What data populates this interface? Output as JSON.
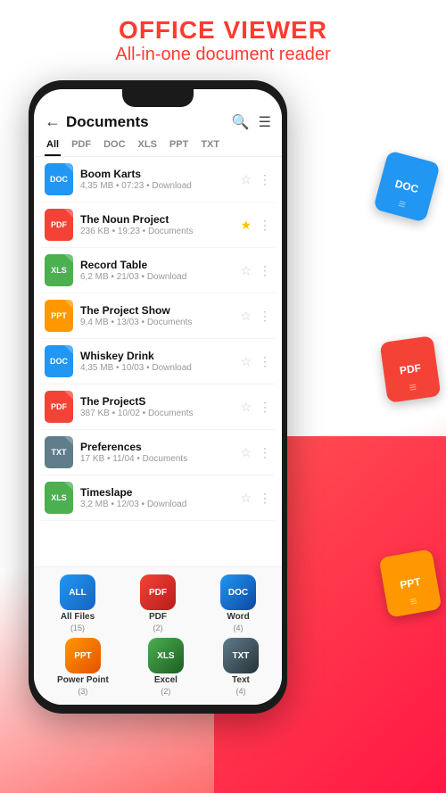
{
  "branding": {
    "title": "OFFICE VIEWER",
    "subtitle": "All-in-one document reader"
  },
  "header": {
    "title": "Documents",
    "back_icon": "←",
    "search_icon": "🔍",
    "sort_icon": "≡"
  },
  "tabs": [
    {
      "label": "All",
      "active": true
    },
    {
      "label": "PDF",
      "active": false
    },
    {
      "label": "DOC",
      "active": false
    },
    {
      "label": "XLS",
      "active": false
    },
    {
      "label": "PPT",
      "active": false
    },
    {
      "label": "TXT",
      "active": false
    }
  ],
  "files": [
    {
      "name": "Boom Karts",
      "meta": "4,35 MB • 07:23 • Download",
      "type": "doc",
      "typeLabel": "DOC",
      "starred": false
    },
    {
      "name": "The Noun Project",
      "meta": "236 KB • 19:23 • Documents",
      "type": "pdf",
      "typeLabel": "PDF",
      "starred": true
    },
    {
      "name": "Record Table",
      "meta": "6,2 MB • 21/03 • Download",
      "type": "xls",
      "typeLabel": "XLS",
      "starred": false
    },
    {
      "name": "The Project Show",
      "meta": "9,4 MB • 13/03 • Documents",
      "type": "ppt",
      "typeLabel": "PPT",
      "starred": false
    },
    {
      "name": "Whiskey Drink",
      "meta": "4,35 MB • 10/03 • Download",
      "type": "doc",
      "typeLabel": "DOC",
      "starred": false
    },
    {
      "name": "The ProjectS",
      "meta": "387 KB • 10/02 • Documents",
      "type": "pdf",
      "typeLabel": "PDF",
      "starred": false
    },
    {
      "name": "Preferences",
      "meta": "17 KB • 11/04 • Documents",
      "type": "txt",
      "typeLabel": "TXT",
      "starred": false
    },
    {
      "name": "Timeslape",
      "meta": "3,2 MB • 12/03 • Download",
      "type": "xls",
      "typeLabel": "XLS",
      "starred": false
    }
  ],
  "bottom_nav": {
    "row1": [
      {
        "label": "All Files",
        "count": "(15)",
        "type": "all",
        "typeLabel": "ALL"
      },
      {
        "label": "PDF",
        "count": "(2)",
        "type": "pdf",
        "typeLabel": "PDF"
      },
      {
        "label": "Word",
        "count": "(4)",
        "type": "word",
        "typeLabel": "DOC"
      }
    ],
    "row2": [
      {
        "label": "Power Point",
        "count": "(3)",
        "type": "ppt",
        "typeLabel": "PPT"
      },
      {
        "label": "Excel",
        "count": "(2)",
        "type": "xls",
        "typeLabel": "XLS"
      },
      {
        "label": "Text",
        "count": "(4)",
        "type": "txt",
        "typeLabel": "TXT"
      }
    ]
  },
  "float_icons": {
    "doc": "DOC",
    "pdf": "PDF",
    "ppt": "PPT"
  }
}
